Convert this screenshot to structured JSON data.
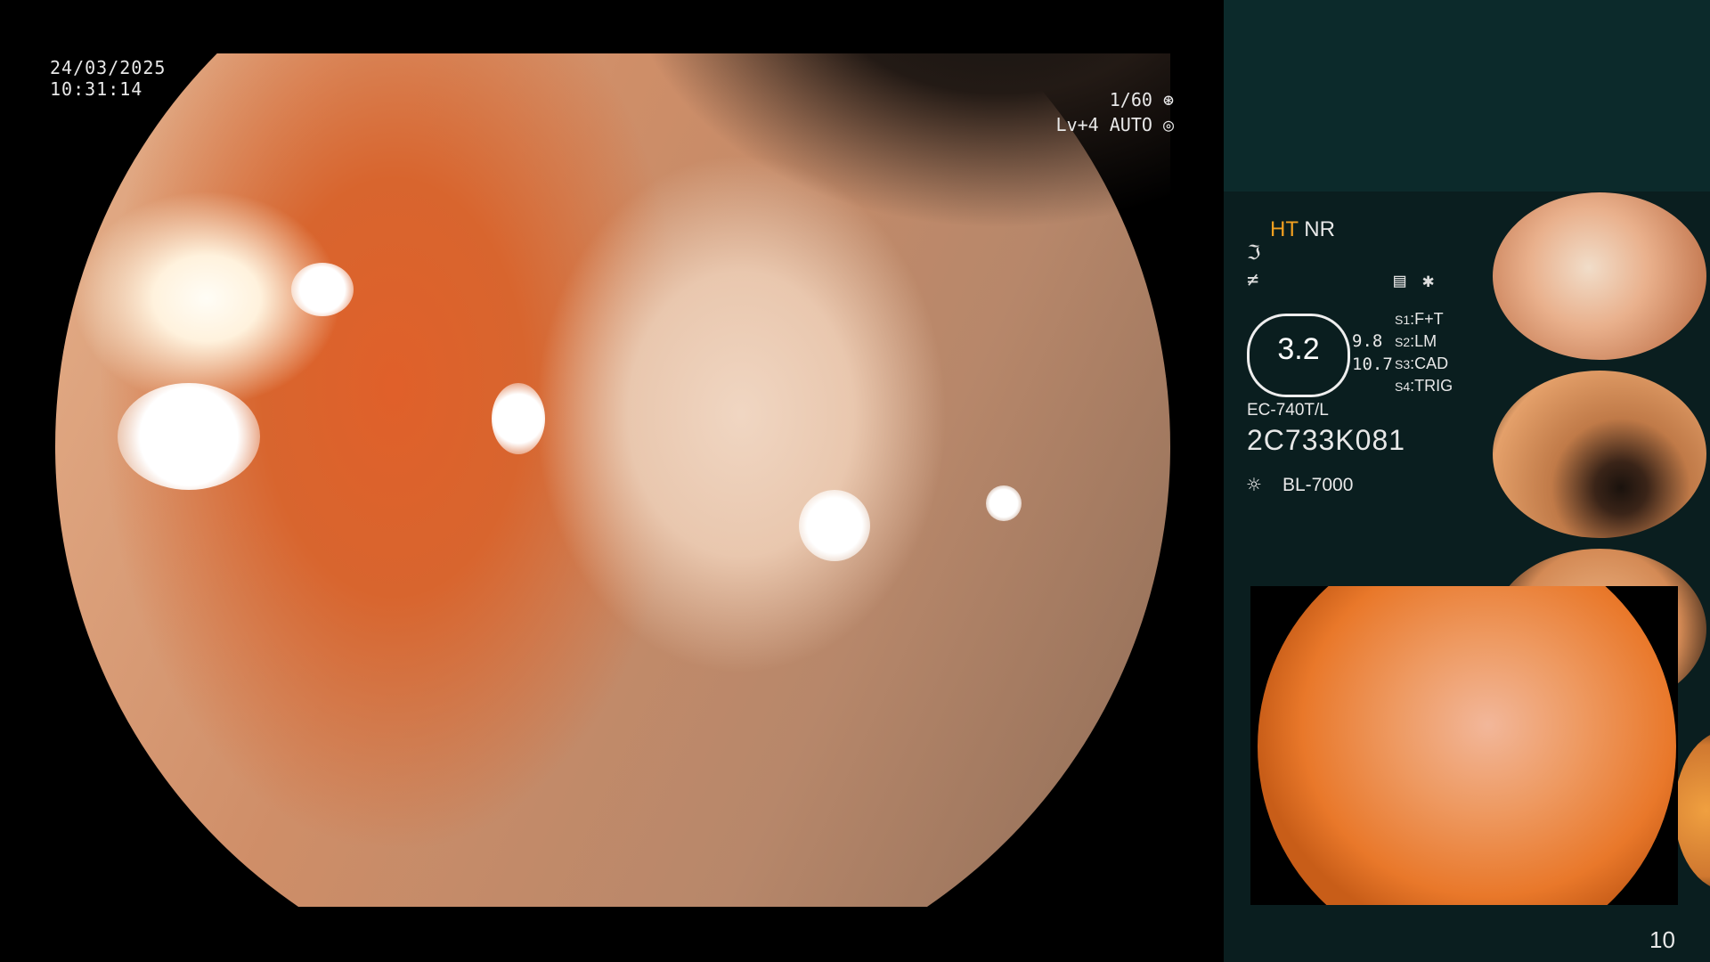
{
  "osd": {
    "date": "24/03/2025",
    "time": "10:31:14",
    "shutter": "1/60",
    "level": "Lv+4  AUTO"
  },
  "panel": {
    "mode_ht": "HT",
    "mode_nr": "NR",
    "gauge_value": "3.2",
    "side_value_1": "9.8",
    "side_value_2": "10.7",
    "slots": [
      {
        "key": "S1",
        "value": "F+T"
      },
      {
        "key": "S2",
        "value": "LM"
      },
      {
        "key": "S3",
        "value": "CAD"
      },
      {
        "key": "S4",
        "value": "TRIG"
      }
    ],
    "scope_model": "EC-740T/L",
    "scope_serial": "2C733K081",
    "light_source": "BL-7000",
    "page_number": "10"
  },
  "icons": {
    "shutter": "shutter-icon",
    "auto": "iris-icon",
    "enhance1": "wave-icon",
    "enhance2": "slash-icon",
    "menu": "menu-icon",
    "star": "asterisk-icon",
    "light": "sun-icon"
  },
  "colors": {
    "panel_bg": "#0a1e1f",
    "panel_top_bg": "#0c2a2b",
    "ht_color": "#f2a020"
  }
}
